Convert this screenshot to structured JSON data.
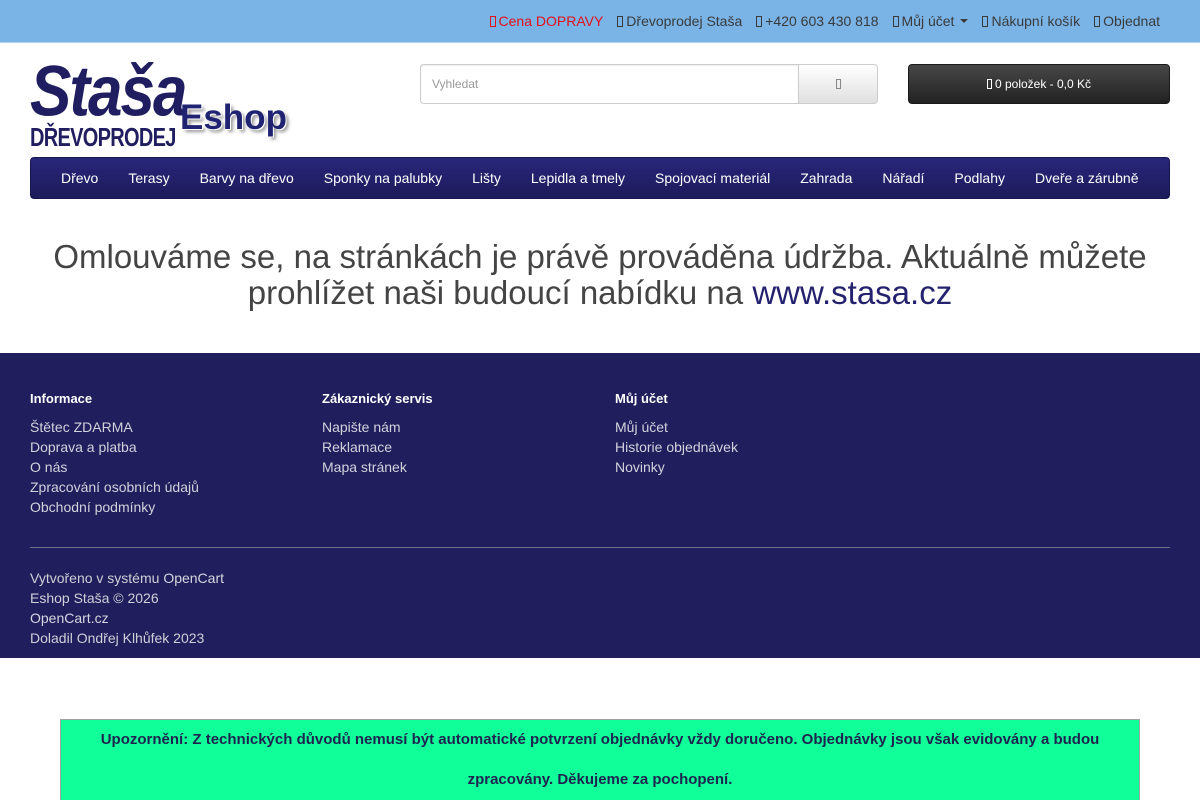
{
  "topbar": {
    "links": [
      {
        "label": "Cena DOPRAVY",
        "icon": "truck-icon"
      },
      {
        "label": "Dřevoprodej Staša",
        "icon": "home-icon"
      },
      {
        "label": "+420 603 430 818",
        "icon": "phone-icon"
      },
      {
        "label": "Můj účet",
        "icon": "user-icon"
      },
      {
        "label": "Nákupní košík",
        "icon": "shopping-cart-icon"
      },
      {
        "label": "Objednat",
        "icon": "share-icon"
      }
    ]
  },
  "logo": {
    "name": "Staša",
    "tagline": "DŘEVOPRODEJ",
    "eshop": "Eshop"
  },
  "header": {
    "search": {
      "placeholder": "Vyhledat",
      "value": "",
      "icon": "search-icon"
    },
    "cart": {
      "label": "0 položek - 0,0 Kč",
      "icon": "shopping-cart-icon"
    }
  },
  "menu": {
    "items": [
      "Dřevo",
      "Terasy",
      "Barvy na dřevo",
      "Sponky na palubky",
      "Lišty",
      "Lepidla a tmely",
      "Spojovací materiál",
      "Zahrada",
      "Nářadí",
      "Podlahy",
      "Dveře a zárubně"
    ]
  },
  "maintenance": {
    "text": "Omlouváme se, na stránkách je právě prováděna údržba. Aktuálně můžete prohlížet naši budoucí nabídku na",
    "link": "www.stasa.cz"
  },
  "footer": {
    "columns": [
      {
        "title": "Informace",
        "items": [
          "Štětec ZDARMA",
          "Doprava a platba",
          "O nás",
          "Zpracování osobních údajů",
          "Obchodní podmínky"
        ]
      },
      {
        "title": "Zákaznický servis",
        "items": [
          "Napište nám",
          "Reklamace",
          "Mapa stránek"
        ]
      },
      {
        "title": "Můj účet",
        "items": [
          "Můj účet",
          "Historie objednávek",
          "Novinky"
        ]
      }
    ],
    "powered_text": "Vytvořeno v systému",
    "powered_link": "OpenCart",
    "copyright": "Eshop Staša © 2026",
    "opencart_link": "OpenCart.cz",
    "credit": "Doladil Ondřej Klhůfek 2023"
  },
  "notice": {
    "text": "Upozornění: Z technických důvodů nemusí být automatické potvrzení objednávky vždy doručeno. Objednávky jsou však evidovány a budou zpracovány. Děkujeme za pochopení."
  },
  "colors": {
    "topbar_bg": "#7ab4e6",
    "brand_navy": "#201e60",
    "footer_bg": "#201e5c",
    "accent_red": "#e3101a",
    "link_navy": "#24226e",
    "notice_bg": "#10ff98"
  }
}
